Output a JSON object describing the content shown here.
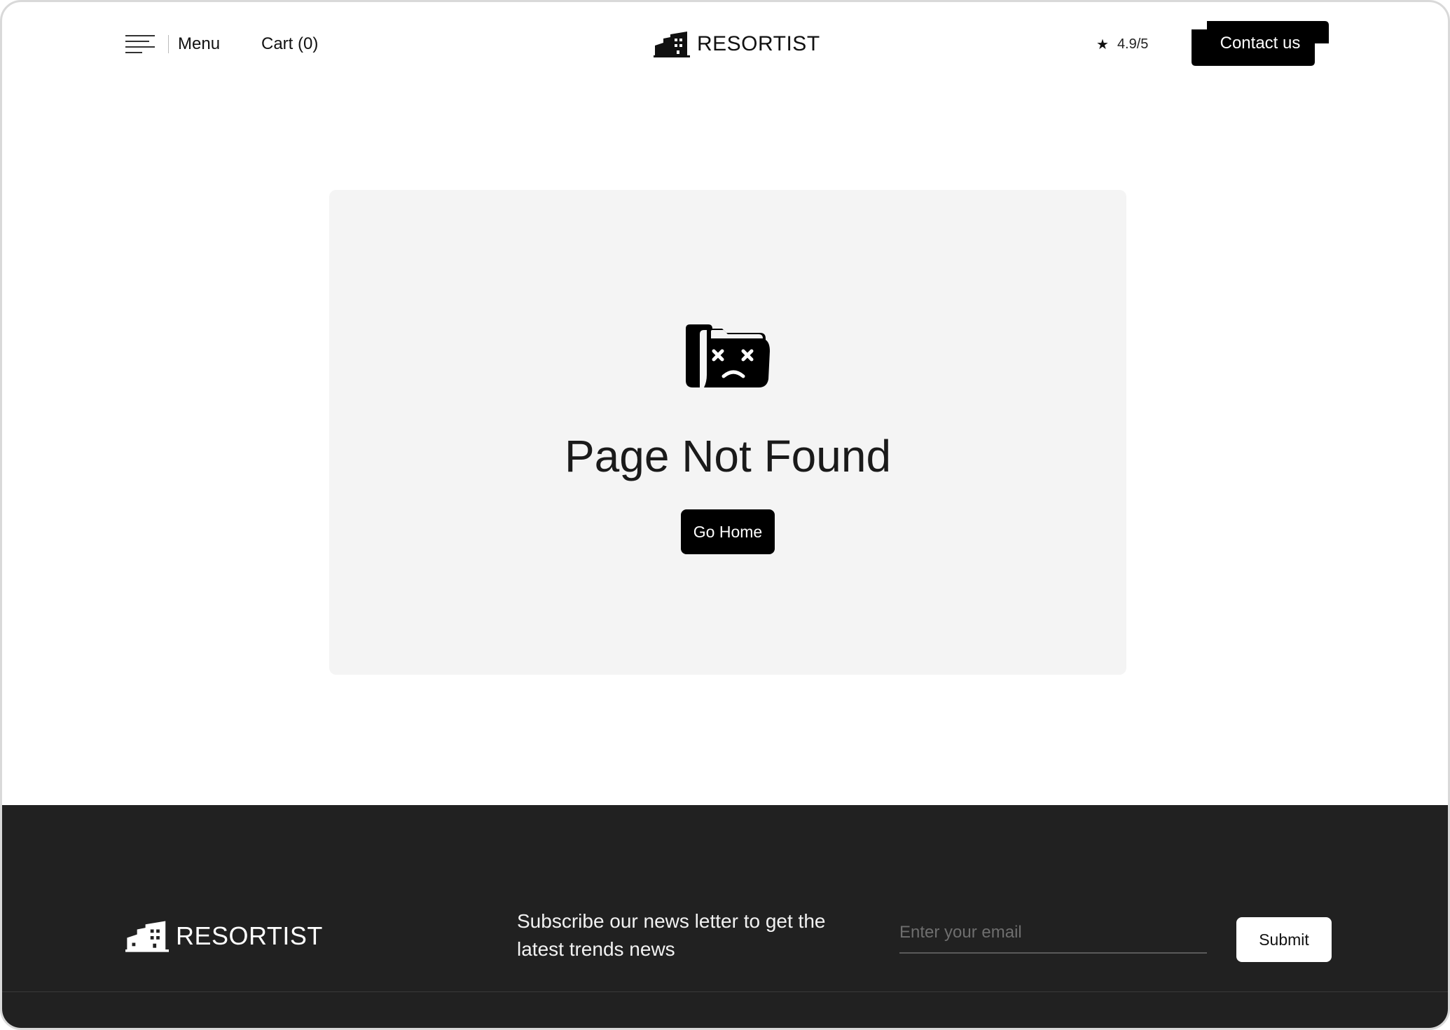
{
  "header": {
    "menu_label": "Menu",
    "cart_label": "Cart (0)",
    "brand": "RESORTIST",
    "rating": "4.9/5",
    "contact_label": "Contact us"
  },
  "main": {
    "title": "Page Not Found",
    "button_label": "Go Home",
    "icon": "sad-folder-icon"
  },
  "footer": {
    "brand": "RESORTIST",
    "subscribe_text": "Subscribe our news letter to get the latest trends news",
    "email_placeholder": "Enter your email",
    "submit_label": "Submit"
  },
  "colors": {
    "accent": "#000000",
    "card_bg": "#f4f4f4",
    "footer_bg": "#212121"
  }
}
